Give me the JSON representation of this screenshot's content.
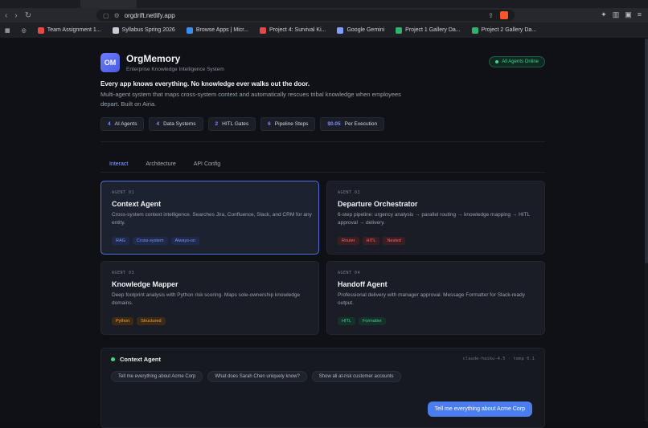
{
  "browser": {
    "url": "orgdrift.netlify.app",
    "bookmarks": [
      {
        "label": "Team Assignment 1...",
        "color": "#e24a4a"
      },
      {
        "label": "Syllabus Spring 2026",
        "color": "#c9ccd3"
      },
      {
        "label": "Browse Apps | Micr...",
        "color": "#3c8df0"
      },
      {
        "label": "Project 4: Survival Ki...",
        "color": "#e24a4a"
      },
      {
        "label": "Google Gemini",
        "color": "#7fa0ff"
      },
      {
        "label": "Project 1 Gallery Da...",
        "color": "#2fb36a"
      },
      {
        "label": "Project 2 Gallery Da...",
        "color": "#2fb36a"
      }
    ]
  },
  "header": {
    "logo": "OM",
    "title": "OrgMemory",
    "subtitle": "Enterprise Knowledge Intelligence System",
    "status": "All Agents Online"
  },
  "hero": {
    "tagline": "Every app knows everything. No knowledge ever walks out the door.",
    "description": "Multi-agent system that maps cross-system context and automatically rescues tribal knowledge when employees depart. Built on Airia."
  },
  "stats": [
    {
      "value": "4",
      "label": "AI Agents"
    },
    {
      "value": "4",
      "label": "Data Systems"
    },
    {
      "value": "2",
      "label": "HITL Gates"
    },
    {
      "value": "6",
      "label": "Pipeline Steps"
    },
    {
      "value": "$0.05",
      "label": "Per Execution"
    }
  ],
  "tabs": [
    "Interact",
    "Architecture",
    "API Config"
  ],
  "agents": [
    {
      "tag": "AGENT 01",
      "title": "Context Agent",
      "desc": "Cross-system context intelligence. Searches Jira, Confluence, Slack, and CRM for any entity.",
      "chips": [
        {
          "t": "RAG",
          "c": "c-blue"
        },
        {
          "t": "Cross-system",
          "c": "c-blue"
        },
        {
          "t": "Always-on",
          "c": "c-blue"
        }
      ]
    },
    {
      "tag": "AGENT 02",
      "title": "Departure Orchestrator",
      "desc": "6-step pipeline: urgency analysis → parallel routing → knowledge mapping → HITL approval → delivery.",
      "chips": [
        {
          "t": "Router",
          "c": "c-red"
        },
        {
          "t": "HITL",
          "c": "c-red"
        },
        {
          "t": "Nested",
          "c": "c-red"
        }
      ]
    },
    {
      "tag": "AGENT 03",
      "title": "Knowledge Mapper",
      "desc": "Deep footprint analysis with Python risk scoring. Maps sole-ownership knowledge domains.",
      "chips": [
        {
          "t": "Python",
          "c": "c-orange"
        },
        {
          "t": "Structured",
          "c": "c-orange"
        }
      ]
    },
    {
      "tag": "AGENT 04",
      "title": "Handoff Agent",
      "desc": "Professional delivery with manager approval. Message Formatter for Slack-ready output.",
      "chips": [
        {
          "t": "HITL",
          "c": "c-green"
        },
        {
          "t": "Formatter",
          "c": "c-green"
        }
      ]
    }
  ],
  "chat": {
    "agent": "Context Agent",
    "model": "claude-haiku-4.5 · temp 0.1",
    "suggestions": [
      "Tell me everything about Acme Corp",
      "What does Sarah Chen uniquely know?",
      "Show all at-risk customer accounts"
    ],
    "message": "Tell me everything about Acme Corp"
  }
}
